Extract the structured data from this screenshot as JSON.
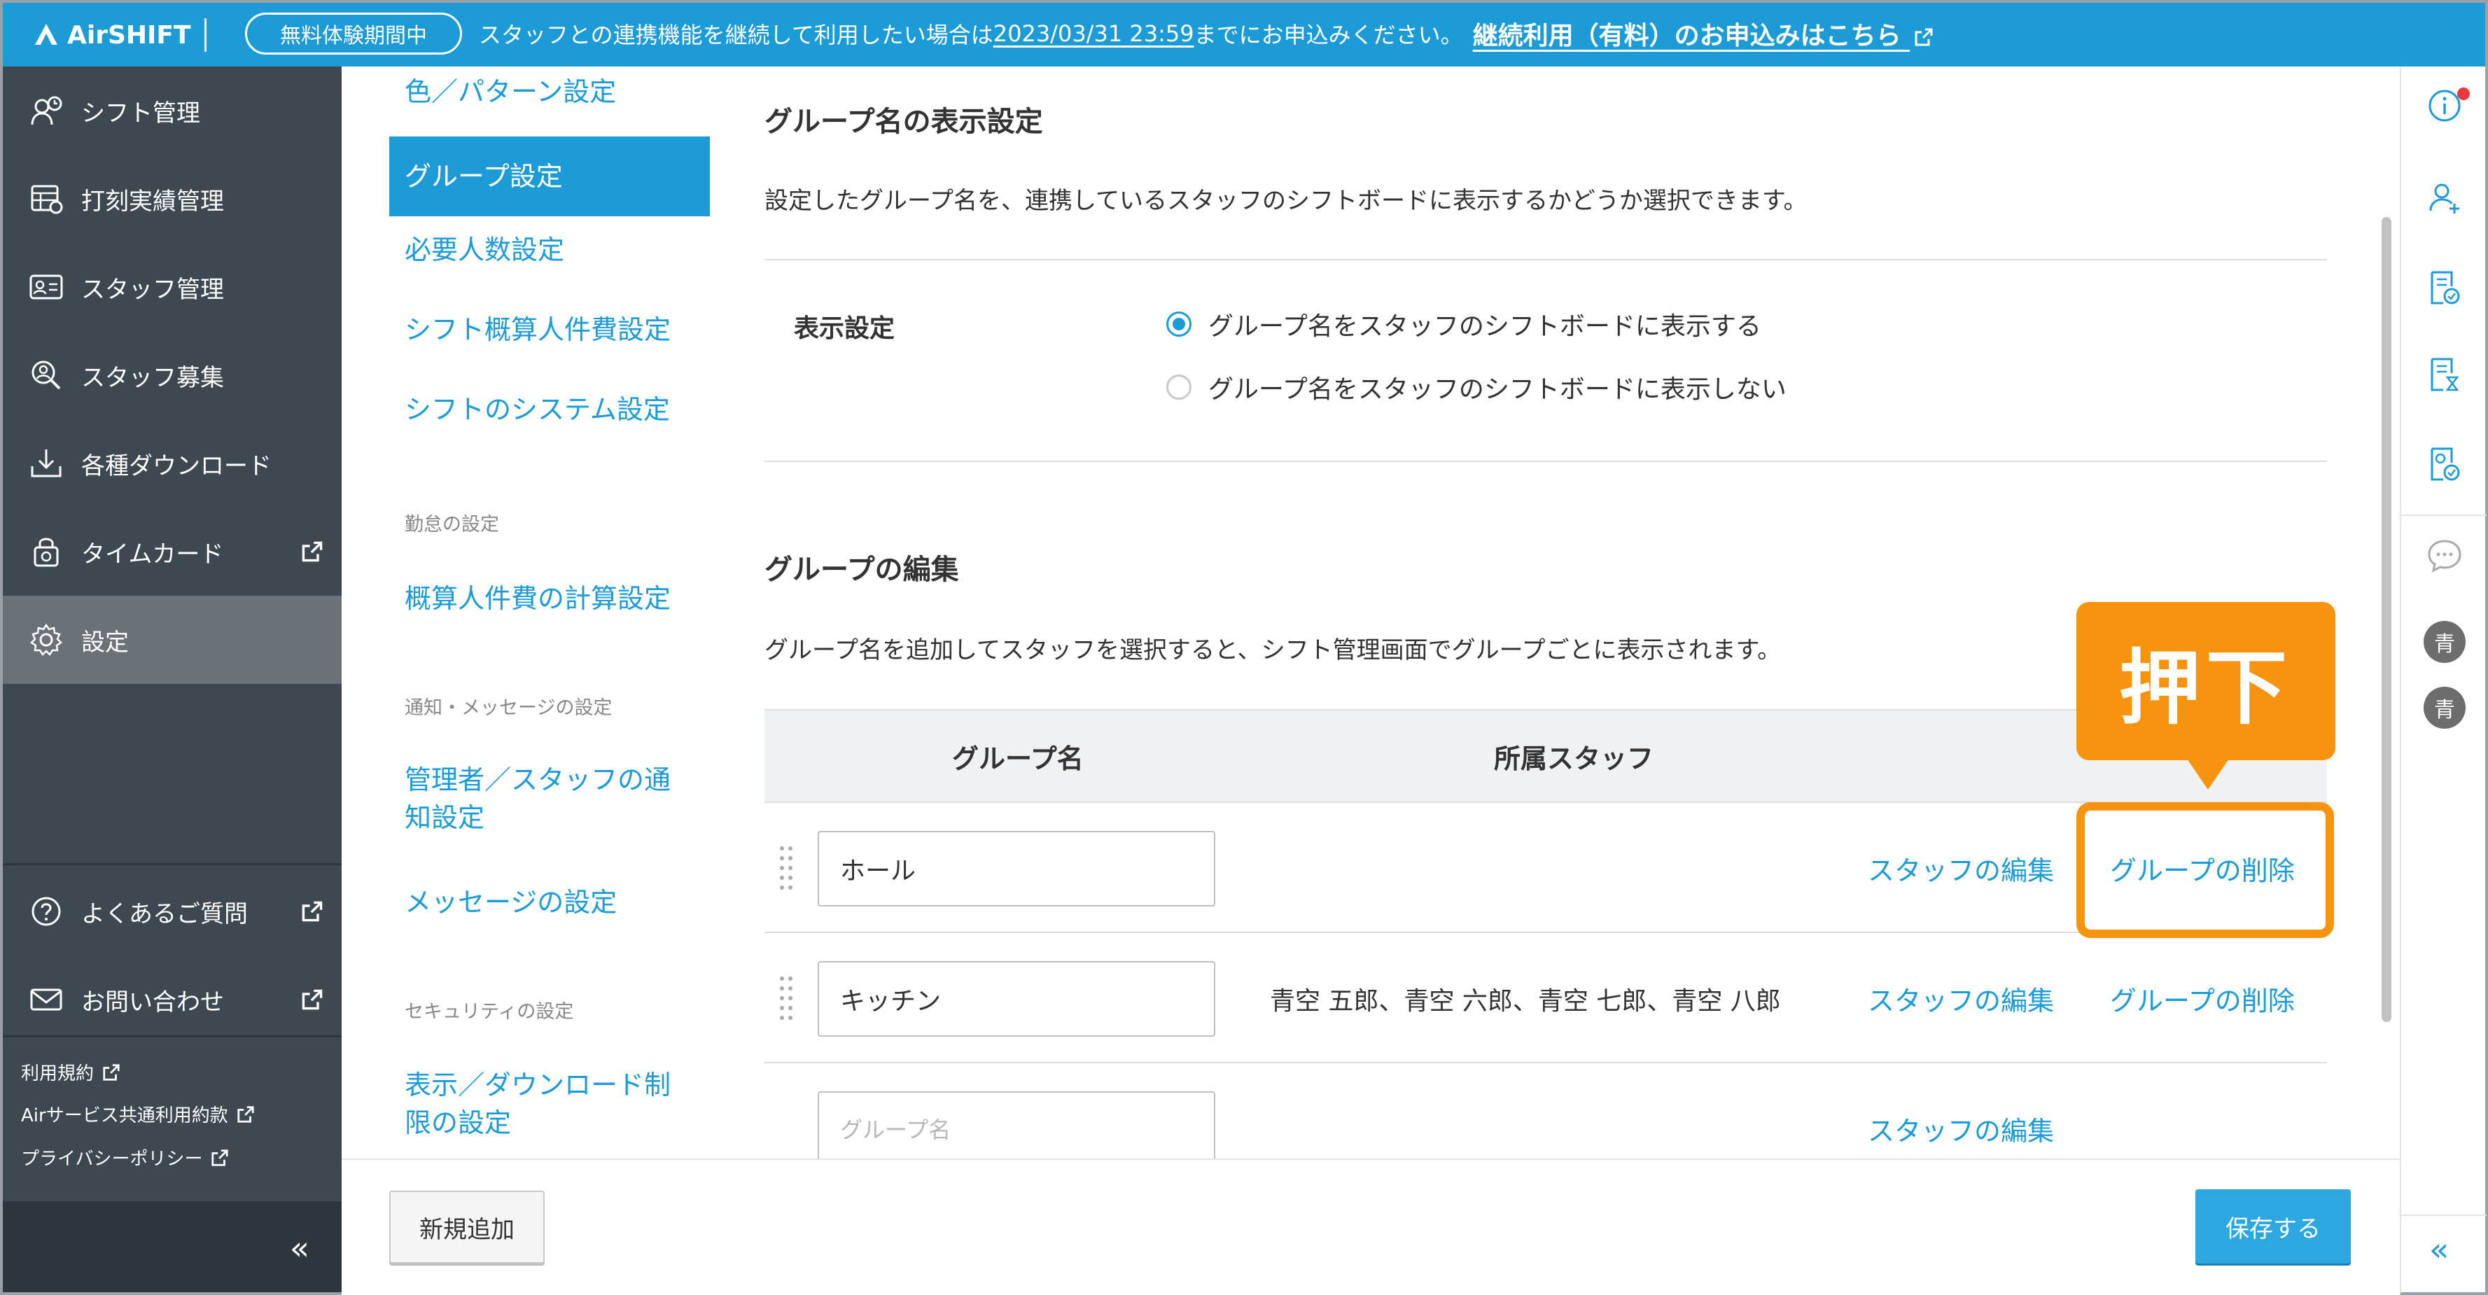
{
  "app": {
    "logo_text": "AirSHIFT",
    "trial_badge": "無料体験期間中",
    "notice_prefix": "スタッフとの連携機能を継続して利用したい場合は",
    "notice_date": "2023/03/31 23:59",
    "notice_suffix": "までにお申込みください。",
    "notice_cta": "継続利用（有料）のお申込みはこちら",
    "brand_color": "#1d9bd7",
    "highlight_color": "#f7930e"
  },
  "sidebar": {
    "items": [
      {
        "label": "シフト管理",
        "icon": "shift-clock-icon"
      },
      {
        "label": "打刻実績管理",
        "icon": "timesheet-icon"
      },
      {
        "label": "スタッフ管理",
        "icon": "staff-card-icon"
      },
      {
        "label": "スタッフ募集",
        "icon": "recruit-search-icon"
      },
      {
        "label": "各種ダウンロード",
        "icon": "download-icon"
      },
      {
        "label": "タイムカード",
        "icon": "timecard-lock-icon"
      },
      {
        "label": "設定",
        "icon": "gear-icon"
      }
    ],
    "help": [
      {
        "label": "よくあるご質問",
        "icon": "question-icon"
      },
      {
        "label": "お問い合わせ",
        "icon": "mail-icon"
      }
    ],
    "links": [
      "利用規約",
      "Airサービス共通利用約款",
      "プライバシーポリシー"
    ],
    "collapse": "«"
  },
  "subnav": {
    "items_top": [
      "色／パターン設定",
      "グループ設定",
      "必要人数設定",
      "シフト概算人件費設定",
      "シフトのシステム設定"
    ],
    "section_attendance": "勤怠の設定",
    "attendance_items": [
      "概算人件費の計算設定"
    ],
    "section_notify": "通知・メッセージの設定",
    "notify_items": [
      "管理者／スタッフの通",
      "知設定",
      "メッセージの設定"
    ],
    "section_security": "セキュリティの設定",
    "security_items": [
      "表示／ダウンロード制",
      "限の設定"
    ]
  },
  "main": {
    "display_section": {
      "title": "グループ名の表示設定",
      "description": "設定したグループ名を、連携しているスタッフのシフトボードに表示するかどうか選択できます。",
      "label": "表示設定",
      "options": [
        "グループ名をスタッフのシフトボードに表示する",
        "グループ名をスタッフのシフトボードに表示しない"
      ],
      "selected_index": 0
    },
    "edit_section": {
      "title": "グループの編集",
      "description": "グループ名を追加してスタッフを選択すると、シフト管理画面でグループごとに表示されます。",
      "columns": [
        "グループ名",
        "所属スタッフ"
      ],
      "rows": [
        {
          "name": "ホール",
          "members": "",
          "edit": "スタッフの編集",
          "delete": "グループの削除"
        },
        {
          "name": "キッチン",
          "members": "青空 五郎、青空 六郎、青空 七郎、青空 八郎",
          "edit": "スタッフの編集",
          "delete": "グループの削除"
        },
        {
          "name": "",
          "members": "",
          "edit": "スタッフの編集",
          "delete": ""
        }
      ],
      "new_placeholder": "グループ名"
    },
    "callout": "押下"
  },
  "footer": {
    "add_button": "新規追加",
    "save_button": "保存する"
  },
  "rail": {
    "icons": [
      "info-icon",
      "add-user-icon",
      "document-check-icon",
      "document-hourglass-icon",
      "document-shield-icon",
      "chat-icon"
    ],
    "avatars": [
      "青",
      "青"
    ],
    "collapse": "«"
  }
}
